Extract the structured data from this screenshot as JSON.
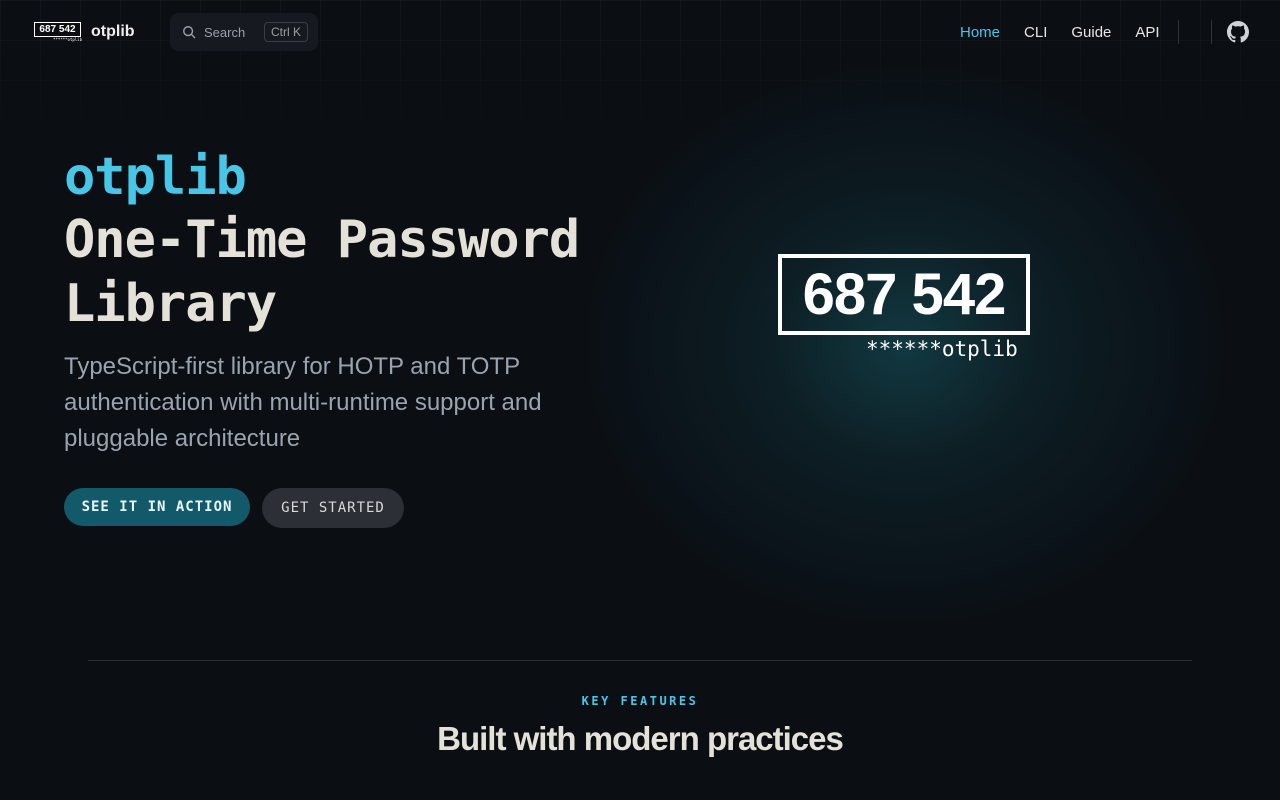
{
  "nav": {
    "logo_code": "687 542",
    "logo_sub": "******otplib",
    "brand": "otplib",
    "search_label": "Search",
    "search_shortcut": "Ctrl K",
    "links": [
      {
        "label": "Home",
        "active": true
      },
      {
        "label": "CLI",
        "active": false
      },
      {
        "label": "Guide",
        "active": false
      },
      {
        "label": "API",
        "active": false
      }
    ],
    "github_icon": "github-icon"
  },
  "hero": {
    "name": "otplib",
    "title": "One-Time Password Library",
    "tagline": "TypeScript-first library for HOTP and TOTP authentication with multi-runtime support and pluggable architecture",
    "primary_cta": "SEE IT IN ACTION",
    "secondary_cta": "GET STARTED",
    "logo_code": "687 542",
    "logo_sub": "******otplib"
  },
  "features": {
    "eyebrow": "KEY FEATURES",
    "title": "Built with modern practices"
  },
  "colors": {
    "background": "#0b0e12",
    "accent": "#48c6e8",
    "primary_button": "#125a6a",
    "secondary_button": "#2c2f36",
    "heading": "#e4e2d8",
    "muted_text": "#9aa3b0"
  }
}
